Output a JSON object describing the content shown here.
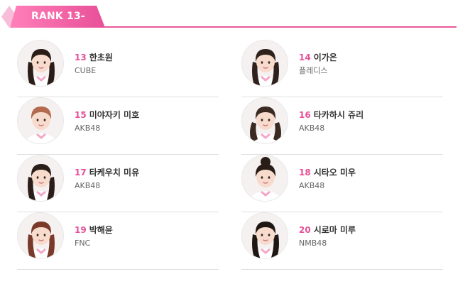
{
  "header": {
    "label": "RANK 13-",
    "accent": "#e84f98"
  },
  "members": [
    {
      "rank": "13",
      "name": "한초원",
      "agency": "CUBE",
      "hair": "#2a1c17",
      "style": "long"
    },
    {
      "rank": "14",
      "name": "이가은",
      "agency": "플레디스",
      "hair": "#2f221c",
      "style": "long"
    },
    {
      "rank": "15",
      "name": "미야자키 미호",
      "agency": "AKB48",
      "hair": "#b46a4e",
      "style": "short"
    },
    {
      "rank": "16",
      "name": "타카하시 쥬리",
      "agency": "AKB48",
      "hair": "#3a2a22",
      "style": "twin"
    },
    {
      "rank": "17",
      "name": "타케우치 미유",
      "agency": "AKB48",
      "hair": "#2b1e19",
      "style": "long"
    },
    {
      "rank": "18",
      "name": "시타오 미우",
      "agency": "AKB48",
      "hair": "#2a1d18",
      "style": "bun"
    },
    {
      "rank": "19",
      "name": "박해윤",
      "agency": "FNC",
      "hair": "#7a3a2a",
      "style": "long"
    },
    {
      "rank": "20",
      "name": "시로마 미루",
      "agency": "NMB48",
      "hair": "#1f1714",
      "style": "long"
    }
  ]
}
